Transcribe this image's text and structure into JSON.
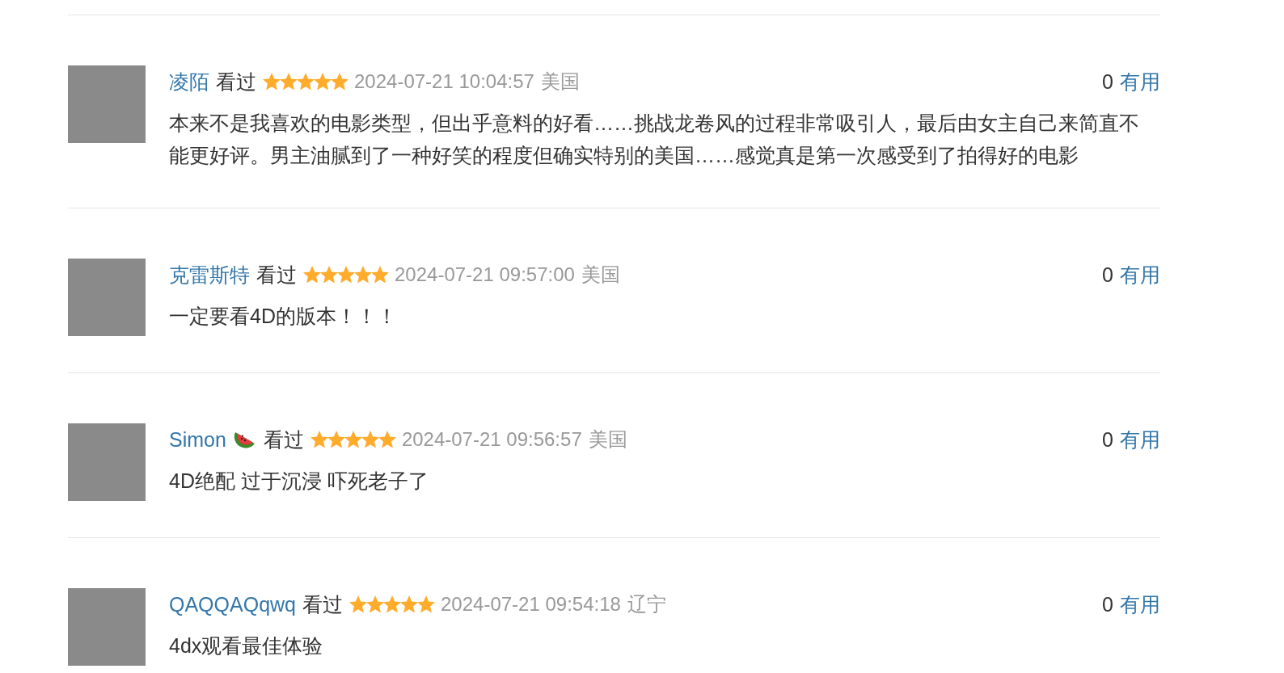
{
  "reviews": [
    {
      "user": "凌陌",
      "has_badge": false,
      "status": "看过",
      "stars": 5,
      "time": "2024-07-21 10:04:57",
      "location": "美国",
      "useful_count": "0",
      "useful_label": "有用",
      "comment": "本来不是我喜欢的电影类型，但出乎意料的好看……挑战龙卷风的过程非常吸引人，最后由女主自己来简直不能更好评。男主油腻到了一种好笑的程度但确实特别的美国……感觉真是第一次感受到了拍得好的电影"
    },
    {
      "user": "克雷斯特",
      "has_badge": false,
      "status": "看过",
      "stars": 5,
      "time": "2024-07-21 09:57:00",
      "location": "美国",
      "useful_count": "0",
      "useful_label": "有用",
      "comment": "一定要看4D的版本！！！"
    },
    {
      "user": "Simon",
      "has_badge": true,
      "status": "看过",
      "stars": 5,
      "time": "2024-07-21 09:56:57",
      "location": "美国",
      "useful_count": "0",
      "useful_label": "有用",
      "comment": "4D绝配 过于沉浸 吓死老子了"
    },
    {
      "user": "QAQQAQqwq",
      "has_badge": false,
      "status": "看过",
      "stars": 5,
      "time": "2024-07-21 09:54:18",
      "location": "辽宁",
      "useful_count": "0",
      "useful_label": "有用",
      "comment": "4dx观看最佳体验"
    }
  ]
}
